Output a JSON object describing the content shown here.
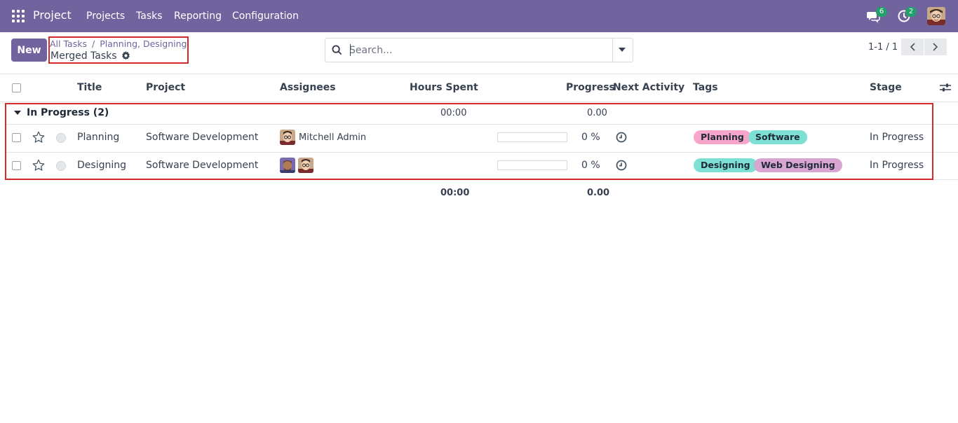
{
  "topbar": {
    "app_name": "Project",
    "menu": [
      "Projects",
      "Tasks",
      "Reporting",
      "Configuration"
    ],
    "messages_badge": "6",
    "activities_badge": "2",
    "icons": [
      "apps-grid-icon",
      "chat-icon",
      "clock-icon",
      "user-avatar"
    ]
  },
  "control": {
    "new_label": "New",
    "breadcrumb": [
      "All Tasks",
      "Planning, Designing"
    ],
    "current": "Merged Tasks",
    "search_placeholder": "Search...",
    "pager": "1-1 / 1"
  },
  "table": {
    "headers": [
      "Title",
      "Project",
      "Assignees",
      "Hours Spent",
      "Progress",
      "Next Activity",
      "Tags",
      "Stage"
    ],
    "group": {
      "label": "In Progress (2)",
      "hours": "00:00",
      "progress": "0.00"
    },
    "rows": [
      {
        "title": "Planning",
        "project": "Software Development",
        "assignee": "Mitchell Admin",
        "progress_label": "0 %",
        "progress_value": 0,
        "tags": [
          "Planning",
          "Software"
        ],
        "stage": "In Progress"
      },
      {
        "title": "Designing",
        "project": "Software Development",
        "assignee": "",
        "progress_label": "0 %",
        "progress_value": 0,
        "tags": [
          "Designing",
          "Web Designing"
        ],
        "stage": "In Progress"
      }
    ],
    "totals": {
      "hours": "00:00",
      "progress": "0.00"
    }
  },
  "colors": {
    "brand": "#71639e",
    "highlight_border": "#d42a2a",
    "tag_pink": "#f7a6c9",
    "tag_teal": "#7ce0d3",
    "tag_mauve": "#d9a6d4",
    "badge_green": "#22a06b"
  }
}
